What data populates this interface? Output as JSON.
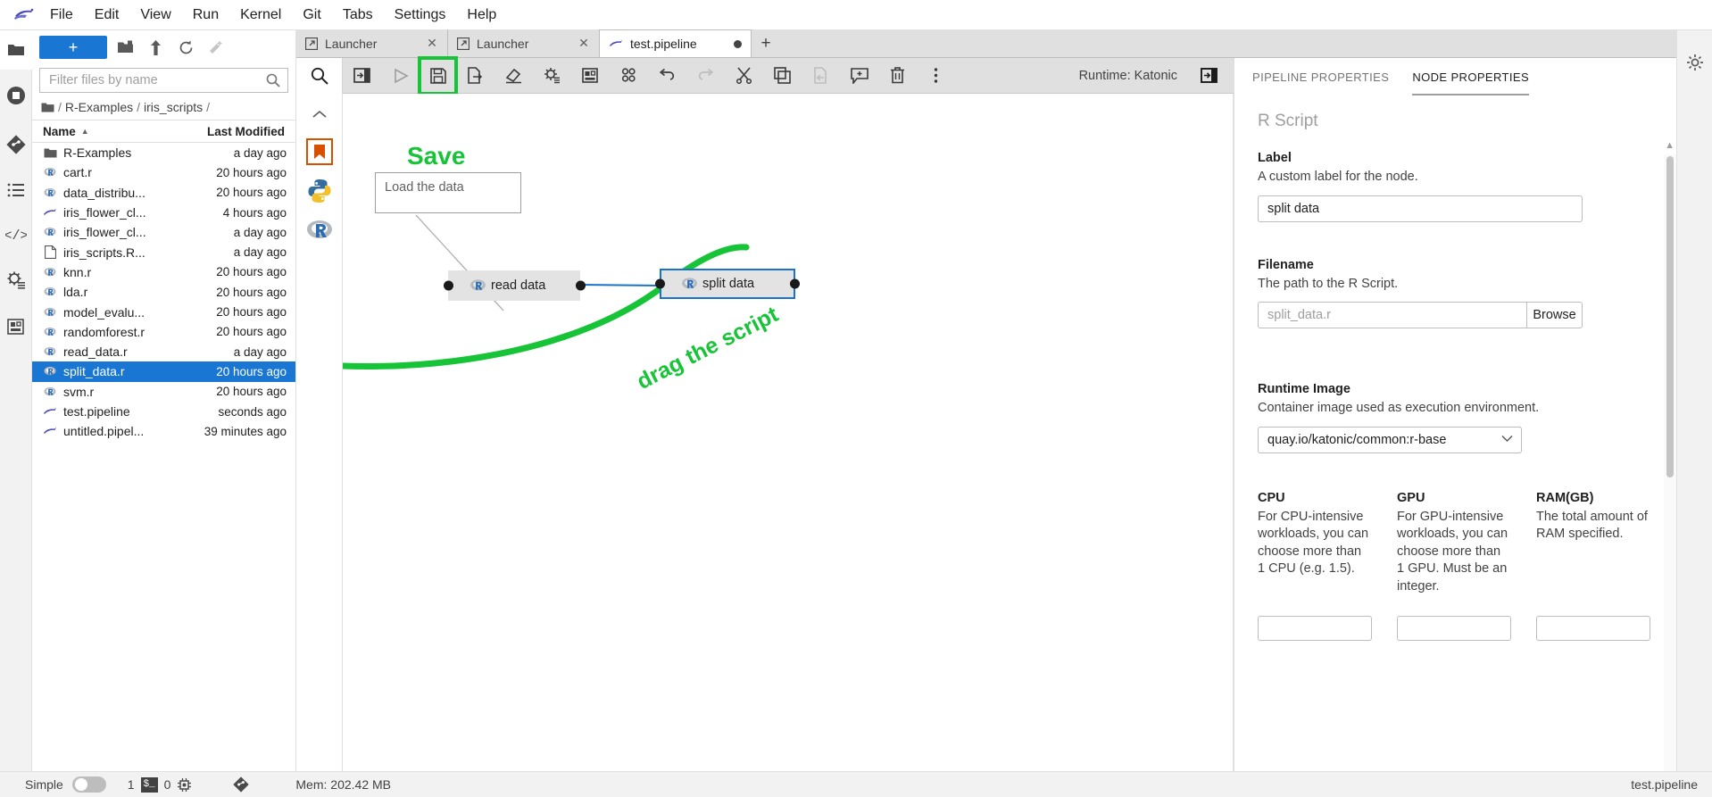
{
  "menubar": {
    "logo_icon": "jupyter-kangaroo-logo",
    "items": [
      {
        "label": "File"
      },
      {
        "label": "Edit"
      },
      {
        "label": "View"
      },
      {
        "label": "Run"
      },
      {
        "label": "Kernel"
      },
      {
        "label": "Git"
      },
      {
        "label": "Tabs"
      },
      {
        "label": "Settings"
      },
      {
        "label": "Help"
      }
    ]
  },
  "activitybar": {
    "items": [
      {
        "name": "file-browser-icon",
        "title": "File Browser"
      },
      {
        "name": "running-terminals-icon",
        "title": "Running Terminals and Kernels"
      },
      {
        "name": "git-icon",
        "title": "Git"
      },
      {
        "name": "table-of-contents-icon",
        "title": "Table of Contents"
      },
      {
        "name": "code-snippets-icon",
        "title": "Code Snippets"
      },
      {
        "name": "runtimes-icon",
        "title": "Runtimes"
      },
      {
        "name": "extension-manager-icon",
        "title": "Extension Manager"
      }
    ]
  },
  "filebrowser": {
    "new_launcher_label": "+",
    "toolbar_icons": [
      "new-folder-icon",
      "upload-icon",
      "refresh-icon",
      "new-checkpoint-icon"
    ],
    "filter_placeholder": "Filter files by name",
    "filter_value": "",
    "search_icon": "search-icon",
    "breadcrumb": {
      "root_icon": "folder-icon",
      "parts": [
        "R-Examples",
        "iris_scripts"
      ]
    },
    "columns": {
      "name": "Name",
      "modified": "Last Modified"
    },
    "sort_arrow": "▲",
    "files": [
      {
        "name": "R-Examples",
        "modified": "a day ago",
        "icon": "folder-icon",
        "selected": false
      },
      {
        "name": "cart.r",
        "modified": "20 hours ago",
        "icon": "r-file-icon",
        "selected": false
      },
      {
        "name": "data_distribu...",
        "modified": "20 hours ago",
        "icon": "r-file-icon",
        "selected": false
      },
      {
        "name": "iris_flower_cl...",
        "modified": "4 hours ago",
        "icon": "pipeline-icon",
        "selected": false
      },
      {
        "name": "iris_flower_cl...",
        "modified": "a day ago",
        "icon": "r-file-icon",
        "selected": false
      },
      {
        "name": "iris_scripts.R...",
        "modified": "a day ago",
        "icon": "generic-file-icon",
        "selected": false
      },
      {
        "name": "knn.r",
        "modified": "20 hours ago",
        "icon": "r-file-icon",
        "selected": false
      },
      {
        "name": "lda.r",
        "modified": "20 hours ago",
        "icon": "r-file-icon",
        "selected": false
      },
      {
        "name": "model_evalu...",
        "modified": "20 hours ago",
        "icon": "r-file-icon",
        "selected": false
      },
      {
        "name": "randomforest.r",
        "modified": "20 hours ago",
        "icon": "r-file-icon",
        "selected": false
      },
      {
        "name": "read_data.r",
        "modified": "a day ago",
        "icon": "r-file-icon",
        "selected": false
      },
      {
        "name": "split_data.r",
        "modified": "20 hours ago",
        "icon": "r-file-icon",
        "selected": true
      },
      {
        "name": "svm.r",
        "modified": "20 hours ago",
        "icon": "r-file-icon",
        "selected": false
      },
      {
        "name": "test.pipeline",
        "modified": "seconds ago",
        "icon": "pipeline-icon",
        "selected": false
      },
      {
        "name": "untitled.pipel...",
        "modified": "39 minutes ago",
        "icon": "pipeline-icon",
        "selected": false
      }
    ]
  },
  "tabs": {
    "items": [
      {
        "label": "Launcher",
        "icon": "launcher-icon",
        "active": false,
        "dirty": false
      },
      {
        "label": "Launcher",
        "icon": "launcher-icon",
        "active": false,
        "dirty": false
      },
      {
        "label": "test.pipeline",
        "icon": "pipeline-icon",
        "active": true,
        "dirty": true
      }
    ],
    "add_label": "+"
  },
  "pipeline_toolbar": {
    "buttons": [
      {
        "name": "open-panel-button",
        "icon": "panel-open-icon",
        "enabled": true
      },
      {
        "name": "run-pipeline-button",
        "icon": "play-icon",
        "enabled": false
      },
      {
        "name": "save-pipeline-button",
        "icon": "save-icon",
        "enabled": true,
        "highlight": true
      },
      {
        "name": "export-pipeline-button",
        "icon": "export-icon",
        "enabled": true
      },
      {
        "name": "clear-pipeline-button",
        "icon": "eraser-icon",
        "enabled": true
      },
      {
        "name": "open-runtimes-button",
        "icon": "gear-list-icon",
        "enabled": true
      },
      {
        "name": "open-runtime-images-button",
        "icon": "image-icon",
        "enabled": true
      },
      {
        "name": "open-component-catalogs-button",
        "icon": "components-icon",
        "enabled": true
      },
      {
        "name": "undo-button",
        "icon": "undo-icon",
        "enabled": true
      },
      {
        "name": "redo-button",
        "icon": "redo-icon",
        "enabled": false
      },
      {
        "name": "cut-button",
        "icon": "scissors-icon",
        "enabled": true
      },
      {
        "name": "copy-button",
        "icon": "copy-icon",
        "enabled": true
      },
      {
        "name": "paste-button",
        "icon": "paste-icon",
        "enabled": false
      },
      {
        "name": "add-comment-button",
        "icon": "comment-plus-icon",
        "enabled": true
      },
      {
        "name": "delete-button",
        "icon": "trash-icon",
        "enabled": true
      },
      {
        "name": "overflow-menu-button",
        "icon": "kebab-menu-icon",
        "enabled": true
      }
    ],
    "runtime_label": "Runtime: Katonic",
    "toggle_panel_icon": "panel-toggle-icon"
  },
  "palette": {
    "search_icon": "search-icon",
    "collapse_icon": "chevron-up-icon",
    "items": [
      {
        "name": "palette-item-generic",
        "icon": "bookmark-orange-icon"
      },
      {
        "name": "palette-item-python",
        "icon": "python-icon"
      },
      {
        "name": "palette-item-r",
        "icon": "r-icon"
      }
    ]
  },
  "canvas": {
    "comment": {
      "text": "Load the data"
    },
    "nodes": [
      {
        "label": "read data",
        "icon": "r-icon",
        "selected": false
      },
      {
        "label": "split data",
        "icon": "r-icon",
        "selected": true
      }
    ],
    "annotations": [
      {
        "text": "Save",
        "color": "#17c437"
      },
      {
        "text": "drag the script",
        "color": "#17c437"
      }
    ],
    "highlight_color": "#17c437",
    "link_color": "#1a73c8"
  },
  "properties": {
    "tabs": [
      {
        "label": "PIPELINE PROPERTIES",
        "active": false
      },
      {
        "label": "NODE PROPERTIES",
        "active": true
      }
    ],
    "node_type": "R Script",
    "fields": {
      "label": {
        "title": "Label",
        "description": "A custom label for the node.",
        "value": "split data",
        "placeholder": ""
      },
      "filename": {
        "title": "Filename",
        "description": "The path to the R Script.",
        "value": "",
        "placeholder": "split_data.r",
        "browse_label": "Browse"
      },
      "runtime_image": {
        "title": "Runtime Image",
        "description": "Container image used as execution environment.",
        "value": "quay.io/katonic/common:r-base",
        "options": [
          "quay.io/katonic/common:r-base"
        ]
      },
      "cpu": {
        "title": "CPU",
        "description": "For CPU-intensive workloads, you can choose more than 1 CPU (e.g. 1.5).",
        "value": "",
        "placeholder": ""
      },
      "gpu": {
        "title": "GPU",
        "description": "For GPU-intensive workloads, you can choose more than 1 GPU. Must be an integer.",
        "value": "",
        "placeholder": ""
      },
      "ram": {
        "title": "RAM(GB)",
        "description": "The total amount of RAM specified.",
        "value": "",
        "placeholder": ""
      }
    }
  },
  "rightrail": {
    "items": [
      {
        "name": "settings-gear-icon"
      }
    ]
  },
  "statusbar": {
    "mode_label": "Simple",
    "mode_on": false,
    "kernel_count": "1",
    "terminal_badge": "$_",
    "terminal_count": "0",
    "kernel_icon": "kernel-icon",
    "git_icon": "git-icon",
    "memory": "Mem: 202.42 MB",
    "document": "test.pipeline"
  }
}
